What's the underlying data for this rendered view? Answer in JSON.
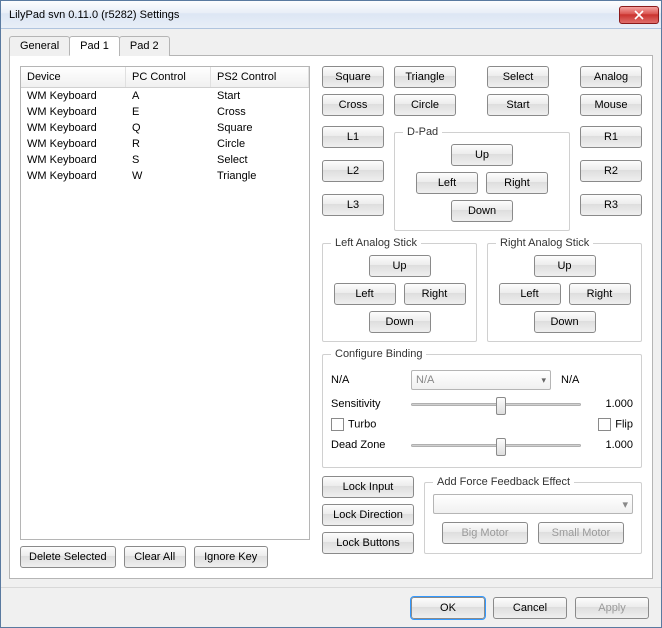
{
  "window": {
    "title": "LilyPad svn 0.11.0 (r5282) Settings"
  },
  "tabs": [
    {
      "label": "General"
    },
    {
      "label": "Pad 1"
    },
    {
      "label": "Pad 2"
    }
  ],
  "active_tab": 1,
  "list": {
    "headers": [
      "Device",
      "PC Control",
      "PS2 Control"
    ],
    "rows": [
      {
        "device": "WM Keyboard",
        "pc": "A",
        "ps2": "Start"
      },
      {
        "device": "WM Keyboard",
        "pc": "E",
        "ps2": "Cross"
      },
      {
        "device": "WM Keyboard",
        "pc": "Q",
        "ps2": "Square"
      },
      {
        "device": "WM Keyboard",
        "pc": "R",
        "ps2": "Circle"
      },
      {
        "device": "WM Keyboard",
        "pc": "S",
        "ps2": "Select"
      },
      {
        "device": "WM Keyboard",
        "pc": "W",
        "ps2": "Triangle"
      }
    ]
  },
  "left_buttons": {
    "delete_selected": "Delete Selected",
    "clear_all": "Clear All",
    "ignore_key": "Ignore Key"
  },
  "face": {
    "square": "Square",
    "triangle": "Triangle",
    "select": "Select",
    "analog": "Analog",
    "cross": "Cross",
    "circle": "Circle",
    "start": "Start",
    "mouse": "Mouse"
  },
  "shoulders": {
    "l1": "L1",
    "l2": "L2",
    "l3": "L3",
    "r1": "R1",
    "r2": "R2",
    "r3": "R3"
  },
  "dpad": {
    "title": "D-Pad",
    "up": "Up",
    "down": "Down",
    "left": "Left",
    "right": "Right"
  },
  "left_stick": {
    "title": "Left Analog Stick",
    "up": "Up",
    "down": "Down",
    "left": "Left",
    "right": "Right"
  },
  "right_stick": {
    "title": "Right Analog Stick",
    "up": "Up",
    "down": "Down",
    "left": "Left",
    "right": "Right"
  },
  "config": {
    "title": "Configure Binding",
    "na_left": "N/A",
    "combo_value": "N/A",
    "na_right": "N/A",
    "sensitivity_label": "Sensitivity",
    "sensitivity_value": "1.000",
    "turbo_label": "Turbo",
    "flip_label": "Flip",
    "deadzone_label": "Dead Zone",
    "deadzone_value": "1.000"
  },
  "locks": {
    "input": "Lock Input",
    "direction": "Lock Direction",
    "buttons": "Lock Buttons"
  },
  "ff": {
    "title": "Add Force Feedback Effect",
    "big": "Big Motor",
    "small": "Small Motor"
  },
  "footer": {
    "ok": "OK",
    "cancel": "Cancel",
    "apply": "Apply"
  }
}
